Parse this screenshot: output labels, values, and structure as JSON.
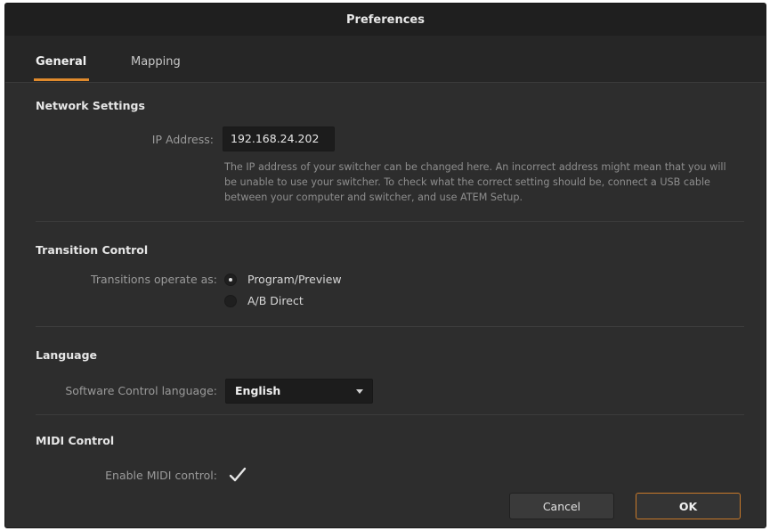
{
  "window": {
    "title": "Preferences"
  },
  "tabs": [
    {
      "label": "General",
      "active": true
    },
    {
      "label": "Mapping",
      "active": false
    }
  ],
  "network": {
    "section_title": "Network Settings",
    "ip_label": "IP Address:",
    "ip_value": "192.168.24.202",
    "help_text": "The IP address of your switcher can be changed here. An incorrect address might mean that you will be unable to use your switcher. To check what the correct setting should be, connect a USB cable between your computer and switcher, and use ATEM Setup."
  },
  "transition": {
    "section_title": "Transition Control",
    "operate_label": "Transitions operate as:",
    "options": [
      {
        "label": "Program/Preview",
        "selected": true
      },
      {
        "label": "A/B Direct",
        "selected": false
      }
    ]
  },
  "language": {
    "section_title": "Language",
    "control_label": "Software Control language:",
    "selected_value": "English"
  },
  "midi": {
    "section_title": "MIDI Control",
    "enable_label": "Enable MIDI control:",
    "enabled": true
  },
  "buttons": {
    "cancel": "Cancel",
    "ok": "OK"
  },
  "colors": {
    "accent": "#e08a2c",
    "background": "#2d2d2d",
    "titlebar": "#1f1f1f"
  }
}
